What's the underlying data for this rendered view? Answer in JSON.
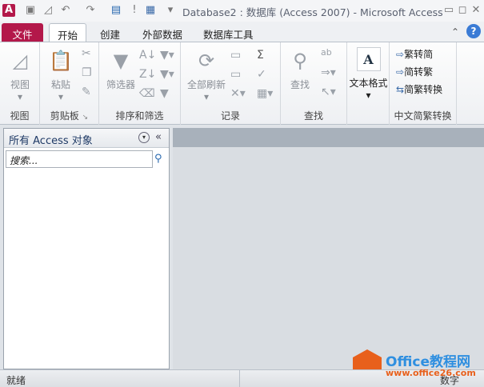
{
  "title": "Database2 : 数据库 (Access 2007)  -  Microsoft Access",
  "tabs": [
    "文件",
    "开始",
    "创建",
    "外部数据",
    "数据库工具"
  ],
  "groups": {
    "view": {
      "label": "视图",
      "buttons": [
        "视图"
      ]
    },
    "clipboard": {
      "label": "剪贴板",
      "buttons": [
        "粘贴"
      ]
    },
    "sort": {
      "label": "排序和筛选",
      "buttons": [
        "筛选器"
      ]
    },
    "records": {
      "label": "记录",
      "buttons": [
        "全部刷新"
      ]
    },
    "find": {
      "label": "查找",
      "buttons": [
        "查找"
      ]
    },
    "text": {
      "label": "",
      "buttons": [
        "文本格式"
      ]
    },
    "chinese": {
      "label": "中文简繁转换",
      "buttons": [
        "繁转简",
        "简转繁",
        "简繁转换"
      ]
    }
  },
  "nav": {
    "title": "所有 Access 对象",
    "search_placeholder": "搜索..."
  },
  "status": {
    "left": "就绪",
    "right": "数字"
  },
  "watermark": {
    "name": "Office教程网",
    "url": "www.office26.com"
  },
  "colors": {
    "file_tab": "#b3184a",
    "watermark": "#e8601c"
  }
}
